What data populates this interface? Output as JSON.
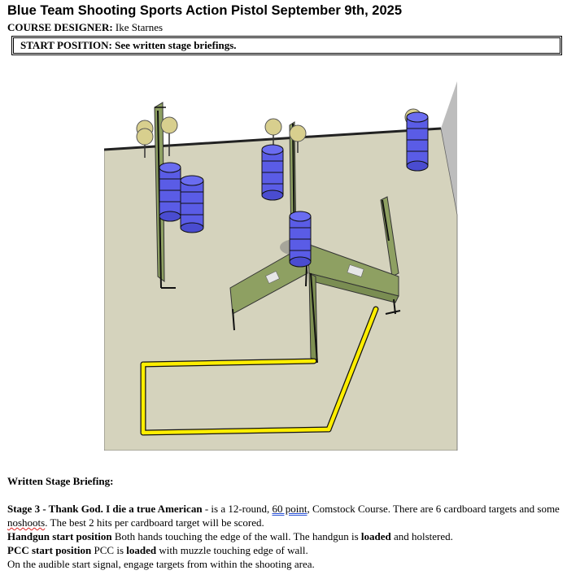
{
  "header": {
    "title": "Blue Team Shooting Sports Action Pistol September 9th, 2025",
    "designer_label": "COURSE DESIGNER:",
    "designer_name": "Ike Starnes",
    "start_position": "START POSITION: See written stage briefings."
  },
  "briefing": {
    "heading": "Written Stage Briefing:",
    "stage_label": "Stage 3 - Thank God. I die a true American",
    "stage_text_1": " - is a 12-round, ",
    "points": "60 point",
    "stage_text_2": ", Comstock Course. There are 6 cardboard targets and some ",
    "noshoots": "noshoots",
    "stage_text_3": ". The best 2 hits per cardboard target will be scored.",
    "handgun_label": "Handgun start position",
    "handgun_text_1": " Both hands touching the edge of the wall. The handgun is ",
    "handgun_loaded": "loaded",
    "handgun_text_2": " and holstered.",
    "pcc_label": "PCC start position",
    "pcc_text_1": " PCC is ",
    "pcc_loaded": "loaded",
    "pcc_text_2": " with muzzle touching edge of wall.",
    "signal_text": "On the audible start signal, engage targets from within the shooting area."
  },
  "colors": {
    "floor": "#d5d3bd",
    "wall": "#8ea062",
    "barrel": "#5a5ce6",
    "fault_line": "#ffee00",
    "target": "#d8cf8e"
  }
}
